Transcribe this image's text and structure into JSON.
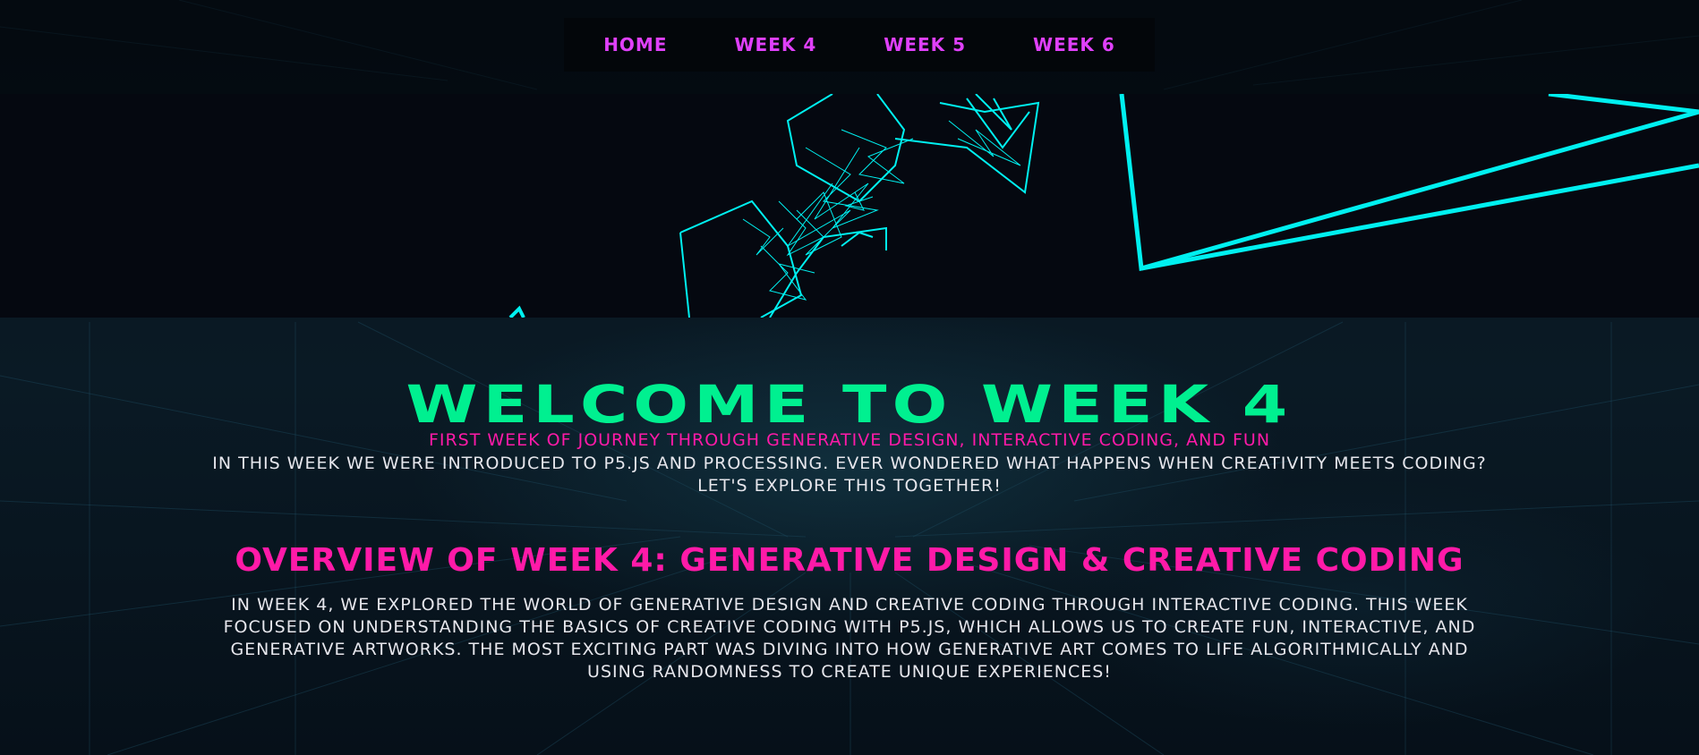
{
  "nav": {
    "items": [
      {
        "label": "HOME"
      },
      {
        "label": "WEEK 4"
      },
      {
        "label": "WEEK 5"
      },
      {
        "label": "WEEK 6"
      }
    ]
  },
  "hero": {
    "title": "WELCOME TO WEEK 4",
    "subtitle": "FIRST WEEK OF JOURNEY THROUGH GENERATIVE DESIGN, INTERACTIVE CODING, AND FUN",
    "intro": "IN THIS WEEK WE WERE INTRODUCED TO P5.JS AND PROCESSING. EVER WONDERED WHAT HAPPENS WHEN CREATIVITY MEETS CODING? LET'S EXPLORE THIS TOGETHER!"
  },
  "overview": {
    "heading": "OVERVIEW OF WEEK 4: GENERATIVE DESIGN & CREATIVE CODING",
    "body": "IN WEEK 4, WE EXPLORED THE WORLD OF GENERATIVE DESIGN AND CREATIVE CODING THROUGH INTERACTIVE CODING. THIS WEEK FOCUSED ON UNDERSTANDING THE BASICS OF CREATIVE CODING WITH P5.JS, WHICH ALLOWS US TO CREATE FUN, INTERACTIVE, AND GENERATIVE ARTWORKS. THE MOST EXCITING PART WAS DIVING INTO HOW GENERATIVE ART COMES TO LIFE ALGORITHMICALLY AND USING RANDOMNESS TO CREATE UNIQUE EXPERIENCES!"
  },
  "colors": {
    "nav": "#e040fb",
    "title": "#00f090",
    "accent": "#ff1aa8",
    "body_text": "#e6e6ec",
    "sketch_stroke": "#00f0f0",
    "background": "#061019"
  }
}
